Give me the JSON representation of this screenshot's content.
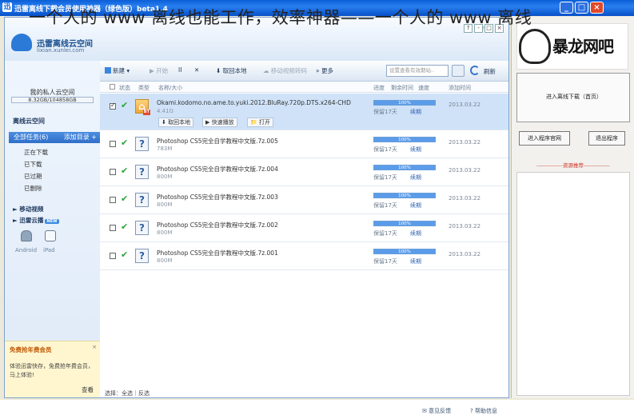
{
  "watermark": "一个人的 www 离线也能工作，效率神器——一个人的 www 离线",
  "window": {
    "title": "迅雷离线下载会员使用神器（绿色版）beta1.4",
    "minimize": "_",
    "maximize": "□",
    "close": "×"
  },
  "top": {
    "logo_name": "迅雷离线云空间",
    "logo_url": "lixian.xunlei.com",
    "links": "???",
    "btns": [
      "?",
      "-",
      "□",
      "×"
    ]
  },
  "sidebar": {
    "user": "我的私人云空间",
    "quota": "8.32GB/104858GB",
    "offline_title": "离线云空间",
    "all_tasks": "全部任务(6)",
    "add_dir": "添加目录 +",
    "sub": [
      "正在下载",
      "已下载",
      "已过期",
      "已删除"
    ],
    "mobile": "移动视频",
    "thunder": "迅雷云播",
    "new_badge": "NEW",
    "devices": [
      "Android",
      "iPad"
    ],
    "promo": {
      "title": "免费抢年费会员",
      "close": "×",
      "body": "体验迅雷快存，免费抢年费会员，马上体验!",
      "link": "查看"
    }
  },
  "toolbar": {
    "new": "新建",
    "start": "开始",
    "pause": "II",
    "delete": "✕",
    "fetch_local": "取回本地",
    "move_video": "移动视频转码",
    "more": "更多",
    "search_placeholder": "设置查看有效期站..",
    "refresh": "刷新"
  },
  "columns": {
    "status": "状态",
    "type": "类型",
    "name": "名称/大小",
    "progress": "进度",
    "remain": "剩余时间",
    "speed": "速度",
    "added": "添加时间"
  },
  "tasks": [
    {
      "name": "Okami.kodomo.no.ame.to.yuki.2012.BluRay.720p.DTS.x264-CHD",
      "size": "4.41G",
      "progress": "100%",
      "keep": "保留17天",
      "renew": "续期",
      "date": "2013.03.22",
      "actions": [
        "取回本地",
        "快速播放",
        "打开"
      ]
    },
    {
      "name": "Photoshop CS5完全自学教程中文版.7z.005",
      "size": "783M",
      "progress": "100%",
      "keep": "保留17天",
      "renew": "续期",
      "date": "2013.03.22"
    },
    {
      "name": "Photoshop CS5完全自学教程中文版.7z.004",
      "size": "800M",
      "progress": "100%",
      "keep": "保留17天",
      "renew": "续期",
      "date": "2013.03.22"
    },
    {
      "name": "Photoshop CS5完全自学教程中文版.7z.003",
      "size": "800M",
      "progress": "100%",
      "keep": "保留17天",
      "renew": "续期",
      "date": "2013.03.22"
    },
    {
      "name": "Photoshop CS5完全自学教程中文版.7z.002",
      "size": "800M",
      "progress": "100%",
      "keep": "保留17天",
      "renew": "续期",
      "date": "2013.03.22"
    },
    {
      "name": "Photoshop CS5完全自学教程中文版.7z.001",
      "size": "800M",
      "progress": "100%",
      "keep": "保留17天",
      "renew": "续期",
      "date": "2013.03.22"
    }
  ],
  "bottom": {
    "select": "选择：全选｜反选",
    "feedback": "意见反馈",
    "help": "帮助信息"
  },
  "right": {
    "logo_text": "暴龙网吧",
    "main_button": "进入离线下载（首页）",
    "enter": "进入程序官网",
    "exit": "退出程序",
    "recommend": "--------------资源推荐--------------"
  },
  "colors": {
    "accent": "#2f6fc8",
    "check": "#30a33a",
    "progress": "#5b9cea"
  }
}
